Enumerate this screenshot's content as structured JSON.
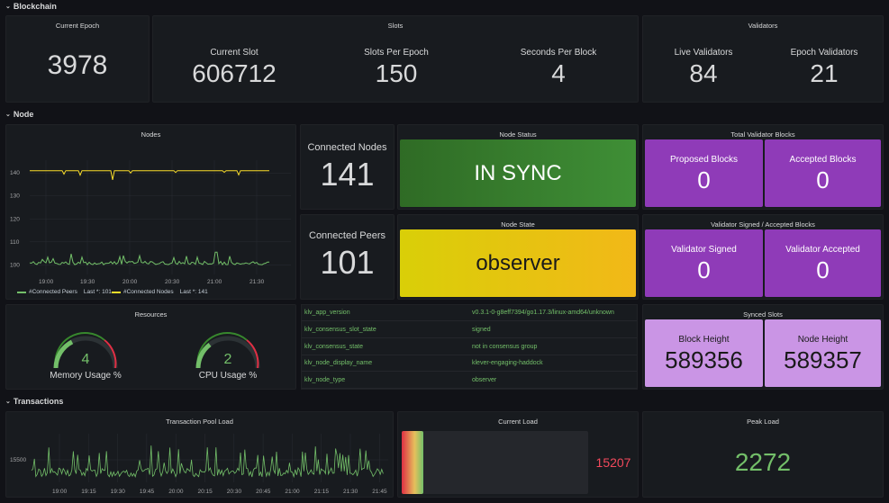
{
  "rows": {
    "blockchain": "Blockchain",
    "node": "Node",
    "transactions": "Transactions"
  },
  "current_epoch": {
    "title": "Current Epoch",
    "value": "3978"
  },
  "slots": {
    "title": "Slots",
    "items": [
      {
        "label": "Current Slot",
        "value": "606712"
      },
      {
        "label": "Slots Per Epoch",
        "value": "150"
      },
      {
        "label": "Seconds Per Block",
        "value": "4"
      }
    ]
  },
  "validators": {
    "title": "Validators",
    "items": [
      {
        "label": "Live Validators",
        "value": "84"
      },
      {
        "label": "Epoch Validators",
        "value": "21"
      }
    ]
  },
  "nodes_chart": {
    "title": "Nodes",
    "legend": [
      {
        "name": "#Connected Peers",
        "last": "Last *: 101",
        "color": "#73bf69"
      },
      {
        "name": "#Connected Nodes",
        "last": "Last *: 141",
        "color": "#fade2a"
      }
    ],
    "y_ticks": [
      "140",
      "130",
      "120",
      "110",
      "100"
    ],
    "x_ticks": [
      "19:00",
      "19:30",
      "20:00",
      "20:30",
      "21:00",
      "21:30"
    ]
  },
  "chart_data": [
    {
      "type": "line",
      "title": "Nodes",
      "ylim": [
        97,
        144
      ],
      "x": [
        "19:00",
        "19:30",
        "20:00",
        "20:30",
        "21:00",
        "21:30"
      ],
      "series": [
        {
          "name": "#Connected Nodes",
          "values": [
            141,
            141,
            140,
            141,
            141,
            141
          ]
        },
        {
          "name": "#Connected Peers",
          "values": [
            101,
            100,
            101,
            100,
            101,
            101
          ]
        }
      ]
    },
    {
      "type": "line",
      "title": "Transaction Pool Load",
      "x": [
        "19:00",
        "19:15",
        "19:30",
        "19:45",
        "20:00",
        "20:15",
        "20:30",
        "20:45",
        "21:00",
        "21:15",
        "21:30",
        "21:45"
      ],
      "y_ticks": [
        "15500"
      ],
      "series": [
        {
          "name": "",
          "values": [
            15180,
            15320,
            15250,
            15400,
            15220,
            15600,
            15300,
            15450,
            15280,
            15520,
            15350,
            15210
          ]
        }
      ]
    }
  ],
  "connected": {
    "nodes_label": "Connected Nodes",
    "nodes_value": "141",
    "peers_label": "Connected Peers",
    "peers_value": "101"
  },
  "node_status": {
    "title": "Node Status",
    "value": "IN SYNC",
    "color": "#37872d"
  },
  "node_state": {
    "title": "Node State",
    "value": "observer",
    "color": "#e0b400"
  },
  "total_validator_blocks": {
    "title": "Total Validator Blocks",
    "items": [
      {
        "label": "Proposed Blocks",
        "value": "0"
      },
      {
        "label": "Accepted Blocks",
        "value": "0"
      }
    ]
  },
  "validator_signed": {
    "title": "Validator Signed / Accepted Blocks",
    "items": [
      {
        "label": "Validator Signed",
        "value": "0"
      },
      {
        "label": "Validator Accepted",
        "value": "0"
      }
    ]
  },
  "synced_slots": {
    "title": "Synced Slots",
    "items": [
      {
        "label": "Block Height",
        "value": "589356"
      },
      {
        "label": "Node Height",
        "value": "589357"
      }
    ]
  },
  "resources": {
    "title": "Resources",
    "gauges": [
      {
        "label": "Memory Usage %",
        "value": "4",
        "level": 0.04
      },
      {
        "label": "CPU Usage %",
        "value": "2",
        "level": 0.02
      }
    ]
  },
  "node_info": [
    {
      "key": "klv_app_version",
      "value": "v0.3.1-0-g8eff7394/go1.17.3/linux-amd64/unknown"
    },
    {
      "key": "klv_consensus_slot_state",
      "value": "signed"
    },
    {
      "key": "klv_consensus_state",
      "value": "not in consensus group"
    },
    {
      "key": "klv_node_display_name",
      "value": "klever-engaging-haddock"
    },
    {
      "key": "klv_node_type",
      "value": "observer"
    }
  ],
  "tx_pool": {
    "title": "Transaction Pool Load",
    "y_tick": "15500",
    "x_ticks": [
      "19:00",
      "19:15",
      "19:30",
      "19:45",
      "20:00",
      "20:15",
      "20:30",
      "20:45",
      "21:00",
      "21:15",
      "21:30",
      "21:45"
    ]
  },
  "current_load": {
    "title": "Current Load",
    "value": "15207",
    "color": "#f2495c"
  },
  "peak_load": {
    "title": "Peak Load",
    "value": "2272",
    "color": "#73bf69"
  },
  "colors": {
    "purple": "#8f3bb8",
    "light_purple": "#ca95e5",
    "green_series": "#73bf69",
    "yellow_series": "#fade2a"
  }
}
